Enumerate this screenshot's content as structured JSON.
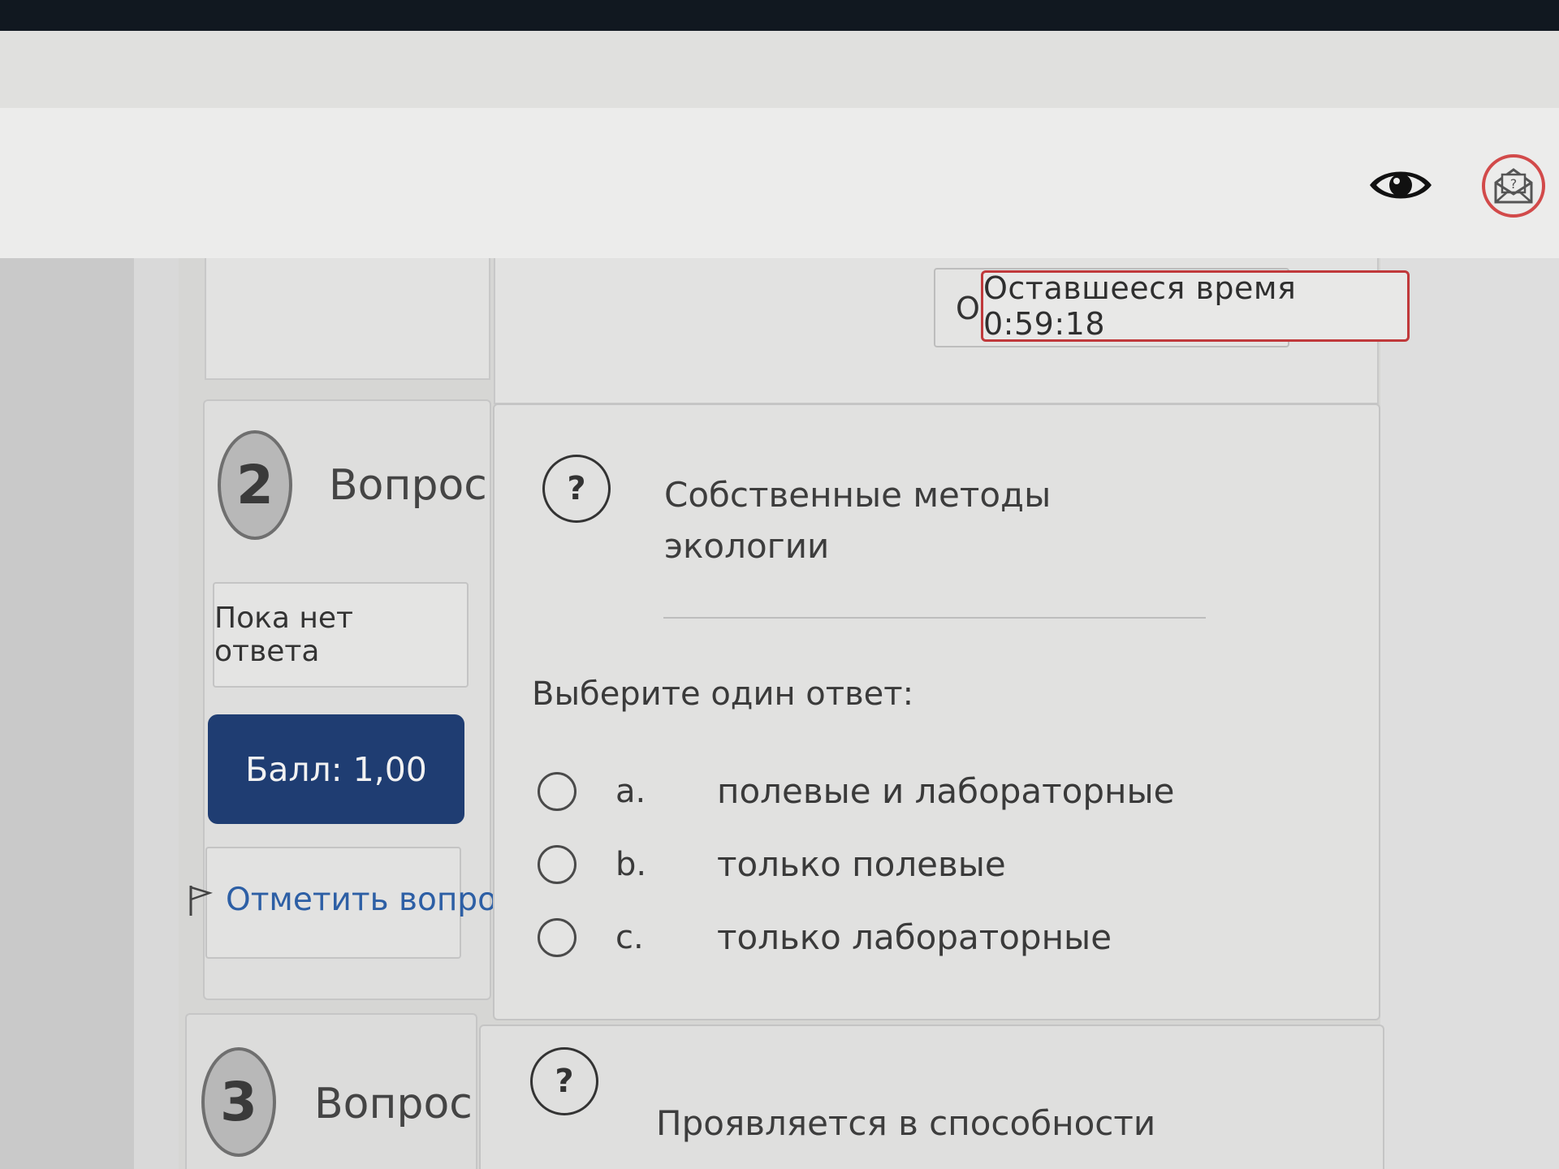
{
  "header": {
    "icons": [
      "eye-icon",
      "mail-question-icon"
    ]
  },
  "timer": {
    "prefix": "О",
    "label": "Оставшееся время 0:59:18"
  },
  "questions": [
    {
      "number": "2",
      "label": "Вопрос",
      "status": "Пока нет ответа",
      "score": "Балл: 1,00",
      "flag_label": "Отметить вопрос",
      "text_line1": "Собственные методы",
      "text_line2": "экологии",
      "prompt": "Выберите один ответ:",
      "options": [
        {
          "letter": "a.",
          "text": "полевые и лабораторные"
        },
        {
          "letter": "b.",
          "text": "только полевые"
        },
        {
          "letter": "c.",
          "text": "только лабораторные"
        }
      ]
    },
    {
      "number": "3",
      "label": "Вопрос",
      "text_line1": "Проявляется в способности"
    }
  ],
  "colors": {
    "score_button": "#1f3d72",
    "flag_link": "#2d5fa5",
    "timer_border": "#c0393b"
  }
}
